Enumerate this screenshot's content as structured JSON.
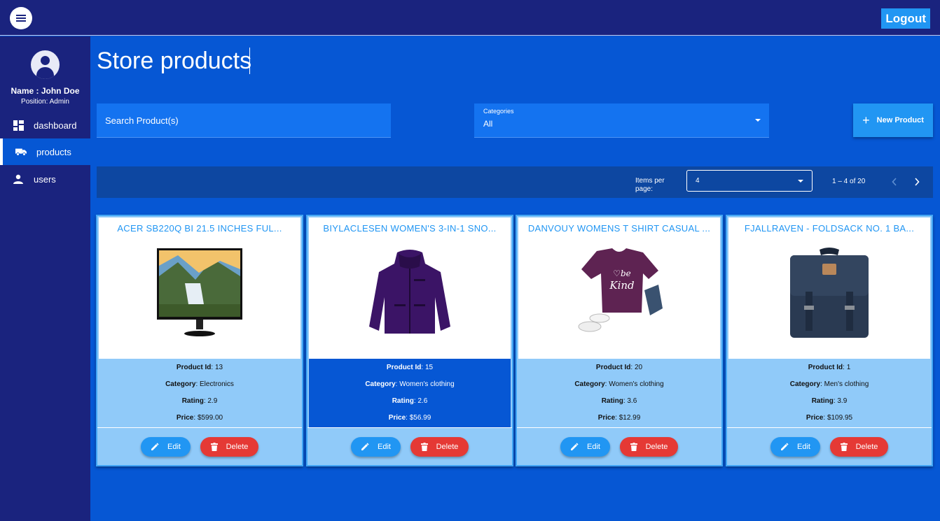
{
  "header": {
    "logout_label": "Logout",
    "menu_icon": "hamburger-menu-icon"
  },
  "sidebar": {
    "user_name": "Name : John Doe",
    "user_position": "Position: Admin",
    "items": [
      {
        "label": "dashboard",
        "icon": "dashboard-icon",
        "active": false
      },
      {
        "label": "products",
        "icon": "truck-icon",
        "active": true
      },
      {
        "label": "users",
        "icon": "person-icon",
        "active": false
      }
    ]
  },
  "main": {
    "title": "Store products",
    "search": {
      "placeholder": "Search Product(s)"
    },
    "categories": {
      "label": "Categories",
      "value": "All"
    },
    "new_product_label": "New Product",
    "paginator": {
      "items_per_page_label": "Items per page:",
      "items_per_page_value": "4",
      "range_label": "1 – 4 of 20"
    },
    "field_labels": {
      "id": "Product Id",
      "category": "Category",
      "rating": "Rating",
      "price": "Price"
    },
    "edit_label": "Edit",
    "delete_label": "Delete",
    "products": [
      {
        "title": "ACER SB220Q BI 21.5 INCHES FUL...",
        "id": "13",
        "category": "Electronics",
        "rating": "2.9",
        "price": "$599.00",
        "image": "monitor-image",
        "highlight": false
      },
      {
        "title": "BIYLACLESEN WOMEN'S 3-IN-1 SNO...",
        "id": "15",
        "category": "Women's clothing",
        "rating": "2.6",
        "price": "$56.99",
        "image": "jacket-image",
        "highlight": true
      },
      {
        "title": "DANVOUY WOMENS T SHIRT CASUAL ...",
        "id": "20",
        "category": "Women's clothing",
        "rating": "3.6",
        "price": "$12.99",
        "image": "tshirt-image",
        "highlight": false
      },
      {
        "title": "FJALLRAVEN - FOLDSACK NO. 1 BA...",
        "id": "1",
        "category": "Men's clothing",
        "rating": "3.9",
        "price": "$109.95",
        "image": "backpack-image",
        "highlight": false
      }
    ]
  }
}
